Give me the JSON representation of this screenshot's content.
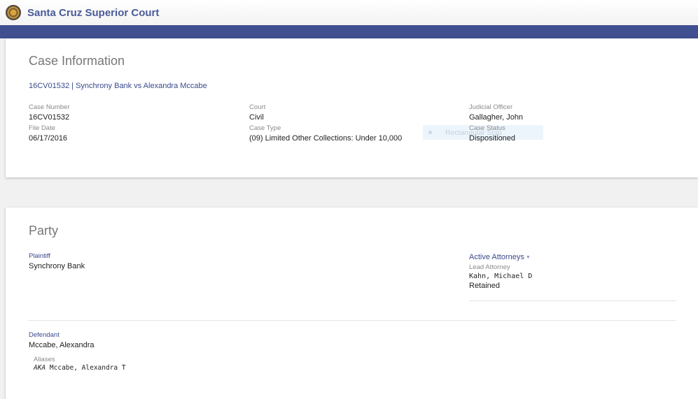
{
  "header": {
    "title": "Santa Cruz Superior Court"
  },
  "case_info": {
    "heading": "Case Information",
    "case_link": "16CV01532 | Synchrony Bank vs Alexandra Mccabe",
    "fields": {
      "case_number": {
        "label": "Case Number",
        "value": "16CV01532"
      },
      "court": {
        "label": "Court",
        "value": "Civil"
      },
      "judicial_officer": {
        "label": "Judicial Officer",
        "value": "Gallagher, John"
      },
      "file_date": {
        "label": "File Date",
        "value": "06/17/2016"
      },
      "case_type": {
        "label": "Case Type",
        "value": "(09) Limited Other Collections: Under 10,000"
      },
      "case_status": {
        "label": "Case Status",
        "value": "Dispositioned"
      }
    },
    "ghost_text": "Rectangular Snip"
  },
  "party": {
    "heading": "Party",
    "plaintiff": {
      "label": "Plaintiff",
      "name": "Synchrony Bank",
      "attorneys_toggle": "Active Attorneys",
      "lead_label": "Lead Attorney",
      "lead_name": "Kahn, Michael D",
      "lead_status": "Retained"
    },
    "defendant": {
      "label": "Defendant",
      "name": "Mccabe, Alexandra",
      "aliases_label": "Aliases",
      "alias_type": "AKA",
      "alias_name": "Mccabe, Alexandra T"
    }
  },
  "colors": {
    "navbar": "#3f4f8f",
    "link": "#3a4a8c",
    "background": "#f1f1f1"
  }
}
